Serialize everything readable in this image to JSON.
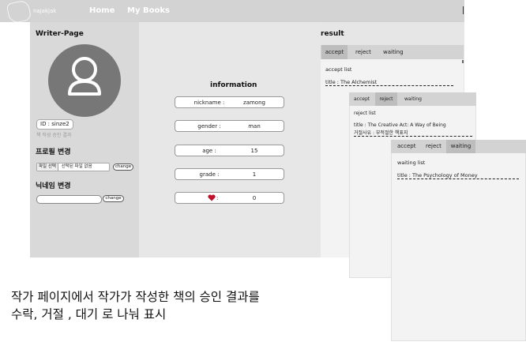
{
  "nav": {
    "brand": "najakjak",
    "home": "Home",
    "my_books": "My Books"
  },
  "left": {
    "title": "Writer-Page",
    "id_label": "ID :  sinze2",
    "approval_hint": "책 작성 승인 결과",
    "profile_change": "프로필 변경",
    "file_select": "파일 선택",
    "file_none": "선택된 파일 없음",
    "change_btn": "change",
    "nickname_change": "닉네임 변경",
    "change_btn2": "change"
  },
  "info": {
    "title": "information",
    "rows": [
      {
        "key": "nickname :",
        "value": "zamong"
      },
      {
        "key": "gender :",
        "value": "man"
      },
      {
        "key": "age :",
        "value": "15"
      },
      {
        "key": "grade :",
        "value": "1"
      },
      {
        "key": ":",
        "value": "0",
        "icon": "heart-icon"
      }
    ]
  },
  "result": {
    "title": "result",
    "tabs": [
      "accept",
      "reject",
      "waiting"
    ],
    "accept": {
      "label": "accept list",
      "item": "title : The Alchemist"
    },
    "reject": {
      "label": "reject list",
      "item": "title : The Creative Act: A Way of Being",
      "reason": "거절사유 : 부적절한 책표지"
    },
    "waiting": {
      "label": "waiting list",
      "item": "title : The Psychology of Money"
    }
  },
  "caption": {
    "line1": "작가 페이지에서 작가가 작성한 책의 승인 결과를",
    "line2": "수락, 거절 , 대기 로 나눠 표시"
  },
  "colors": {
    "nav": "#d3d3d3",
    "left_panel": "#d9d9d9",
    "avatar": "#777777",
    "heart": "#c0102a"
  }
}
